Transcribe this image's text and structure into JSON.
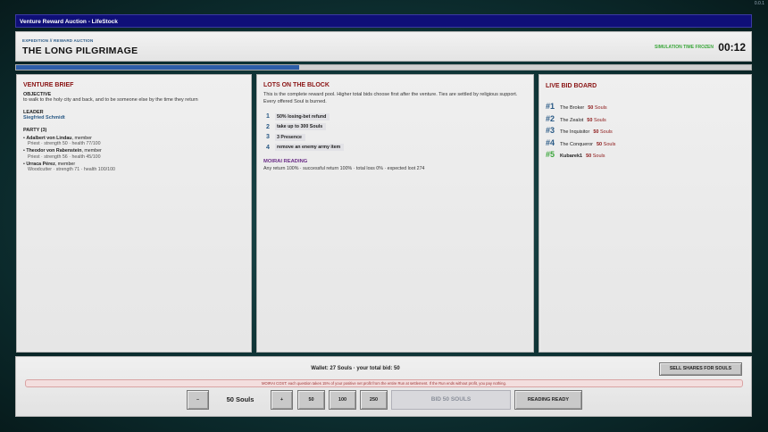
{
  "version": "0.0.1",
  "window": {
    "title": "Venture Reward Auction - LifeStock"
  },
  "header": {
    "kicker": "EXPEDITION // REWARD AUCTION",
    "title": "THE LONG PILGRIMAGE",
    "status": "SIMULATION TIME FROZEN",
    "timer": "00:12",
    "progress_fraction": 0.385
  },
  "brief": {
    "title": "VENTURE BRIEF",
    "objective_label": "OBJECTIVE",
    "objective": "to walk to the holy city and back, and to be someone else by the time they return",
    "leader_label": "LEADER",
    "leader": "Siegfried Schmidt",
    "party_label": "PARTY (3)",
    "party": [
      {
        "name": "Adalbert von Lindau",
        "role": ", member",
        "stats": "Priest · strength 50 · health 77/100"
      },
      {
        "name": "Theodor von Rabenstein",
        "role": ", member",
        "stats": "Priest · strength 56 · health 45/100"
      },
      {
        "name": "Urraca Pérez",
        "role": ", member",
        "stats": "Woodcutter · strength 71 · health 100/100"
      }
    ]
  },
  "lots": {
    "title": "LOTS ON THE BLOCK",
    "description": "This is the complete reward pool. Higher total bids choose first after the venture. Ties are settled by religious support. Every offered Soul is burned.",
    "items": [
      {
        "num": "1",
        "label": "50% losing-bet refund"
      },
      {
        "num": "2",
        "label": "take up to 300 Souls"
      },
      {
        "num": "3",
        "label": "3 Presence"
      },
      {
        "num": "4",
        "label": "remove an enemy army item"
      }
    ],
    "moirai_title": "MOIRAI READING",
    "moirai_text": "Any return 100% · successful return 100% · total loss 0% · expected loot 274"
  },
  "bidboard": {
    "title": "LIVE BID BOARD",
    "bids": [
      {
        "rank": "#1",
        "name": "The Broker",
        "amount": "50",
        "unit": "Souls"
      },
      {
        "rank": "#2",
        "name": "The Zealot",
        "amount": "50",
        "unit": "Souls"
      },
      {
        "rank": "#3",
        "name": "The Inquisitor",
        "amount": "50",
        "unit": "Souls"
      },
      {
        "rank": "#4",
        "name": "The Conqueror",
        "amount": "50",
        "unit": "Souls"
      },
      {
        "rank": "#5",
        "name": "Kubarek1",
        "amount": "50",
        "unit": "Souls"
      }
    ]
  },
  "footer": {
    "wallet": "Wallet: 27 Souls · your total bid: 50",
    "sell_label": "SELL SHARES FOR SOULS",
    "notice": "MOIRAI COST: each question takes 15% of your positive net profit from the entire Run at settlement. If the Run ends without profit, you pay nothing.",
    "minus_label": "–",
    "amount": "50 Souls",
    "plus_label": "+",
    "quick": [
      "50",
      "100",
      "250"
    ],
    "bid_label": "BID 50 SOULS",
    "ready_label": "READING READY"
  },
  "colors": {
    "titlebar": "#0f0f78",
    "accent_red": "#8a1414",
    "accent_blue": "#2a5a86",
    "accent_green": "#3aa63a",
    "progress": "#2d5da8"
  }
}
